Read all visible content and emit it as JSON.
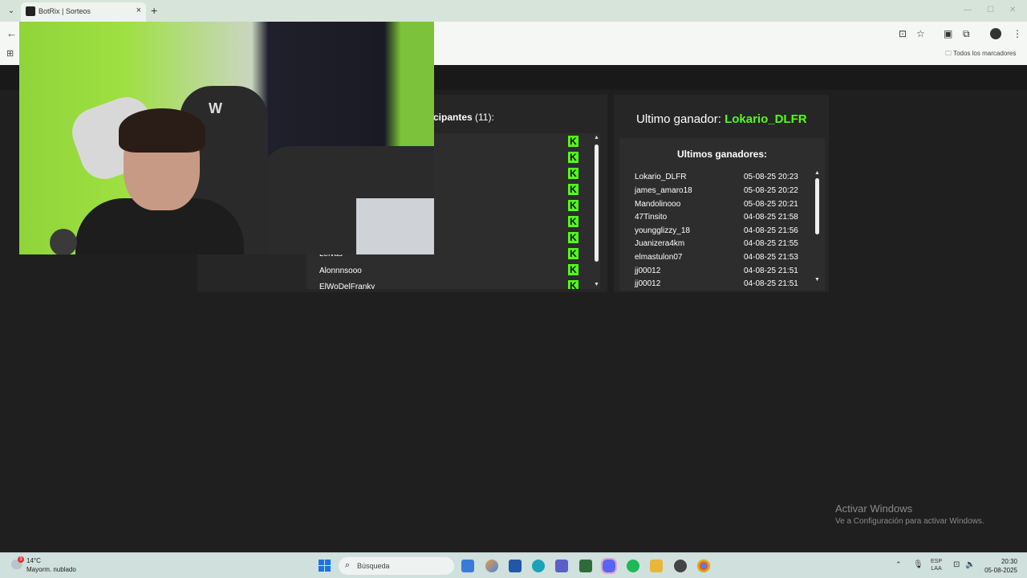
{
  "browser": {
    "tab_title": "BotRix | Sorteos",
    "bookmarks_label": "Todos los marcadores"
  },
  "participants": {
    "title": "cipantes",
    "count": "(11):",
    "visible_names": [
      "Leivas",
      "Alonnnsooo",
      "ElWoDelFranky"
    ]
  },
  "winner": {
    "label": "Ultimo ganador:",
    "name": "Lokario_DLFR"
  },
  "history": {
    "title": "Ultimos ganadores:",
    "rows": [
      {
        "name": "Lokario_DLFR",
        "date": "05-08-25 20:23"
      },
      {
        "name": "james_amaro18",
        "date": "05-08-25 20:22"
      },
      {
        "name": "Mandolinooo",
        "date": "05-08-25 20:21"
      },
      {
        "name": "47Tinsito",
        "date": "04-08-25 21:58"
      },
      {
        "name": "youngglizzy_18",
        "date": "04-08-25 21:56"
      },
      {
        "name": "Juanizera4km",
        "date": "04-08-25 21:55"
      },
      {
        "name": "elmastulon07",
        "date": "04-08-25 21:53"
      },
      {
        "name": "jj00012",
        "date": "04-08-25 21:51"
      },
      {
        "name": "jj00012",
        "date": "04-08-25 21:51"
      }
    ]
  },
  "watermark": {
    "title": "Activar Windows",
    "subtitle": "Ve a Configuración para activar Windows."
  },
  "taskbar": {
    "weather_badge": "3",
    "temperature": "14°C",
    "weather_desc": "Mayorm. nublado",
    "search_placeholder": "Búsqueda",
    "lang_top": "ESP",
    "lang_bottom": "LAA",
    "time": "20:30",
    "date": "05-08-2025"
  },
  "colors": {
    "accent": "#53fc18",
    "panel": "#262626",
    "background": "#1f1f1f"
  }
}
